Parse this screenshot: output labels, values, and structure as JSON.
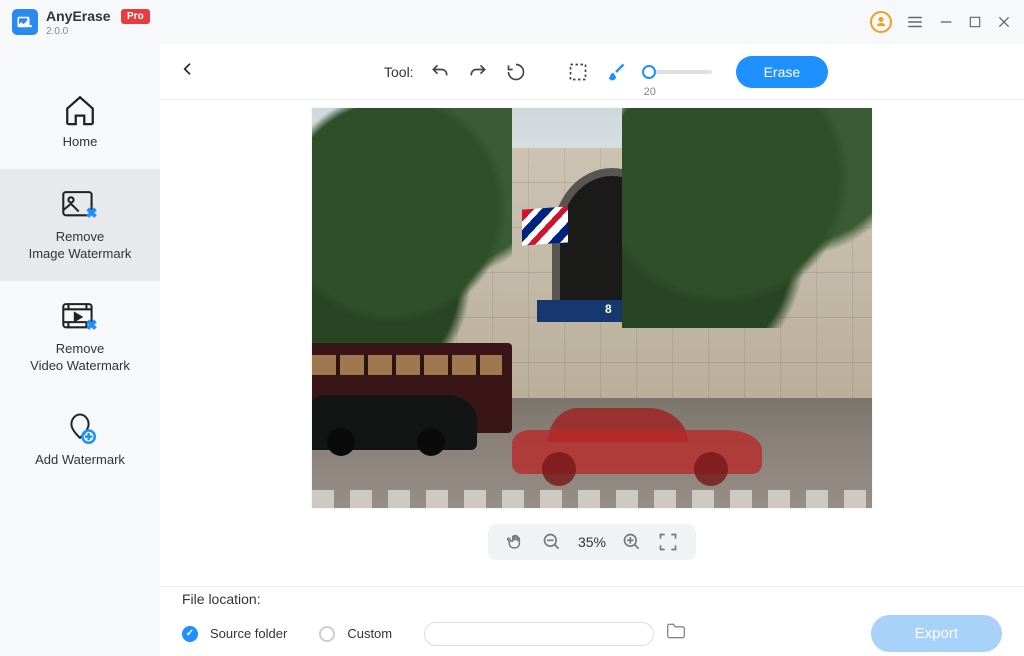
{
  "app": {
    "name": "AnyErase",
    "version": "2.0.0",
    "badge": "Pro"
  },
  "sidebar": {
    "items": [
      {
        "label": "Home"
      },
      {
        "label": "Remove\nImage Watermark"
      },
      {
        "label": "Remove\nVideo Watermark"
      },
      {
        "label": "Add Watermark"
      }
    ],
    "active_index": 1
  },
  "toolbar": {
    "tool_label": "Tool:",
    "brush_value": "20",
    "erase_label": "Erase"
  },
  "zoom": {
    "value": "35%"
  },
  "image": {
    "awning_number": "8"
  },
  "footer": {
    "location_label": "File location:",
    "source_label": "Source folder",
    "custom_label": "Custom",
    "export_label": "Export"
  }
}
